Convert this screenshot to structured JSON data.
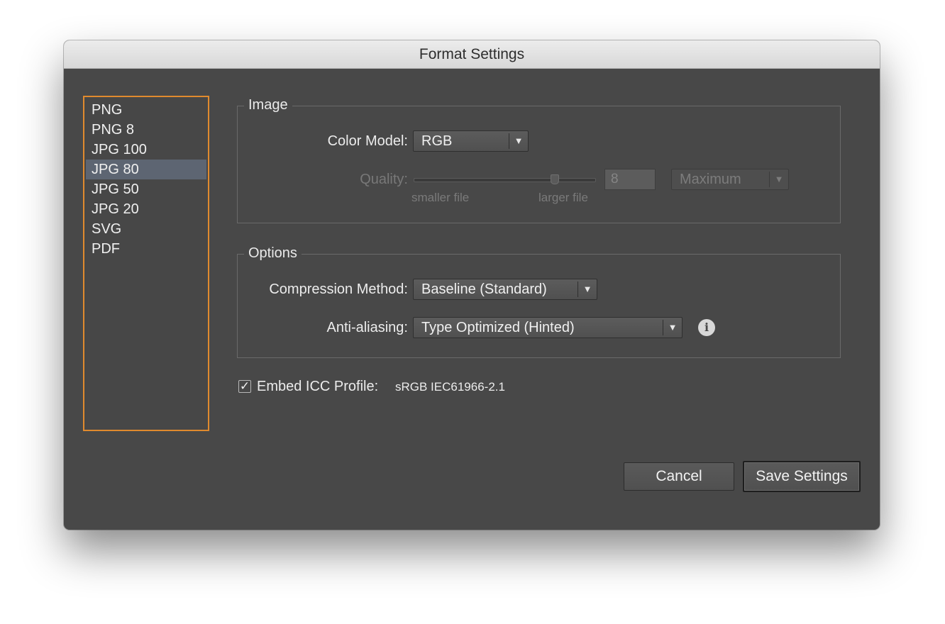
{
  "window": {
    "title": "Format Settings"
  },
  "presets": {
    "items": [
      "PNG",
      "PNG 8",
      "JPG 100",
      "JPG 80",
      "JPG 50",
      "JPG 20",
      "SVG",
      "PDF"
    ],
    "selected": "JPG 80"
  },
  "image_group": {
    "title": "Image",
    "color_model_label": "Color Model:",
    "color_model_value": "RGB",
    "quality_label": "Quality:",
    "quality_value": "8",
    "quality_level": 0.8,
    "quality_min_label": "smaller file",
    "quality_max_label": "larger file",
    "quality_preset_value": "Maximum"
  },
  "options_group": {
    "title": "Options",
    "compression_label": "Compression Method:",
    "compression_value": "Baseline (Standard)",
    "antialiasing_label": "Anti-aliasing:",
    "antialiasing_value": "Type Optimized (Hinted)"
  },
  "icc": {
    "checked": true,
    "label": "Embed ICC Profile:",
    "profile": "sRGB IEC61966-2.1"
  },
  "buttons": {
    "cancel": "Cancel",
    "save": "Save Settings"
  },
  "icons": {
    "dropdown": "chevron-down-icon",
    "info": "info-icon",
    "check": "checkmark-icon"
  },
  "colors": {
    "selection_border": "#e08a2e",
    "selected_row": "#5d6572",
    "dialog_background": "#484848"
  }
}
